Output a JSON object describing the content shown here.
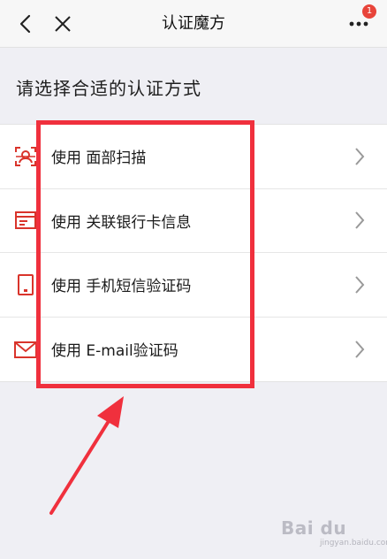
{
  "navbar": {
    "title": "认证魔方",
    "badge_count": "1",
    "back_icon": "chevron-left-icon",
    "close_icon": "close-icon",
    "more_icon": "more-dots-icon"
  },
  "section_title": "请选择合适的认证方式",
  "options": [
    {
      "label": "使用 面部扫描",
      "icon": "face-scan-icon"
    },
    {
      "label": "使用 关联银行卡信息",
      "icon": "bank-card-icon"
    },
    {
      "label": "使用 手机短信验证码",
      "icon": "phone-icon"
    },
    {
      "label": "使用 E-mail验证码",
      "icon": "mail-icon"
    }
  ],
  "colors": {
    "accent_red": "#e8443a",
    "highlight": "#f0303d",
    "icon_red": "#d9342b"
  },
  "watermark": {
    "main": "Bai du",
    "sub": "jingyan.baidu.com"
  }
}
